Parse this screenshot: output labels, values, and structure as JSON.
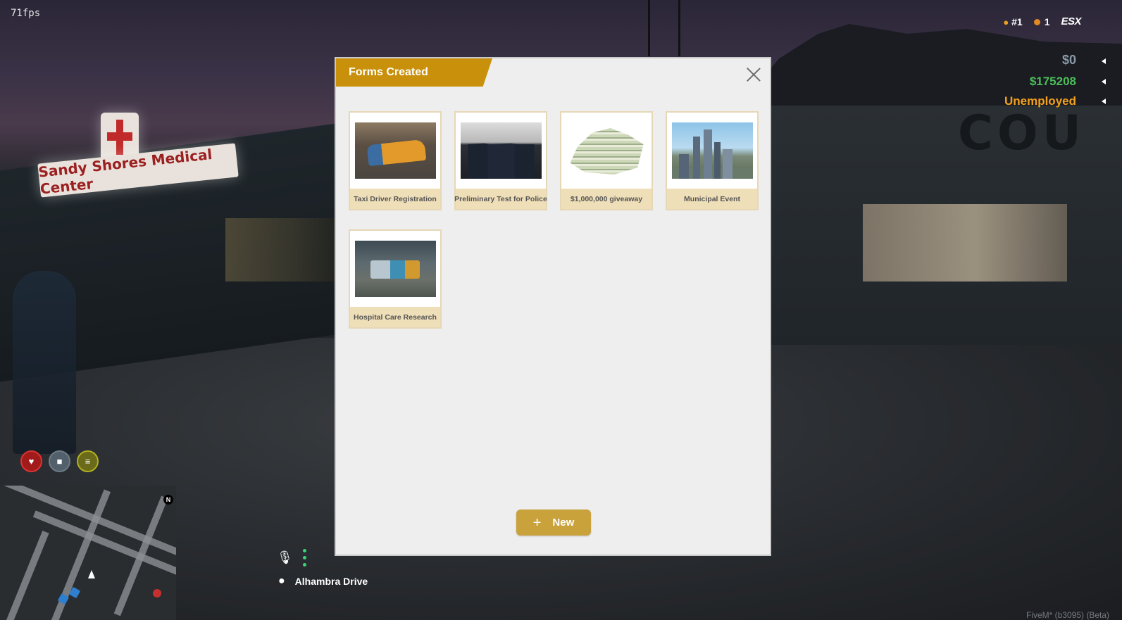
{
  "hud": {
    "fps": "71fps",
    "player_id": "#1",
    "coins": "1",
    "server_logo": "ESX",
    "cash": "$0",
    "bank": "$175208",
    "job": "Unemployed",
    "street": "Alhambra Drive",
    "build": "FiveM* (b3095) (Beta)"
  },
  "status": {
    "health_icon": "heart-icon",
    "thirst_icon": "water-icon",
    "hunger_icon": "food-icon"
  },
  "minimap": {
    "north": "N"
  },
  "background": {
    "sign": "Sandy Shores Medical Center",
    "building_text": "COU"
  },
  "modal": {
    "title": "Forms Created",
    "close_icon": "close-icon",
    "forms": [
      {
        "label": "Taxi Driver Registration",
        "image": "taxi"
      },
      {
        "label": "Preliminary Test for Police",
        "image": "police"
      },
      {
        "label": "$1,000,000 giveaway",
        "image": "cash"
      },
      {
        "label": "Municipal Event",
        "image": "city"
      },
      {
        "label": "Hospital Care Research",
        "image": "hospital"
      }
    ],
    "new_button": {
      "icon": "+",
      "label": "New"
    }
  },
  "colors": {
    "accent": "#c8900b",
    "button": "#c9a23c",
    "card_label_bg": "#efdfb8",
    "modal_bg": "#eeeeee",
    "cash": "#8a9aa8",
    "bank": "#4cbe5a",
    "job": "#f4a01e"
  }
}
